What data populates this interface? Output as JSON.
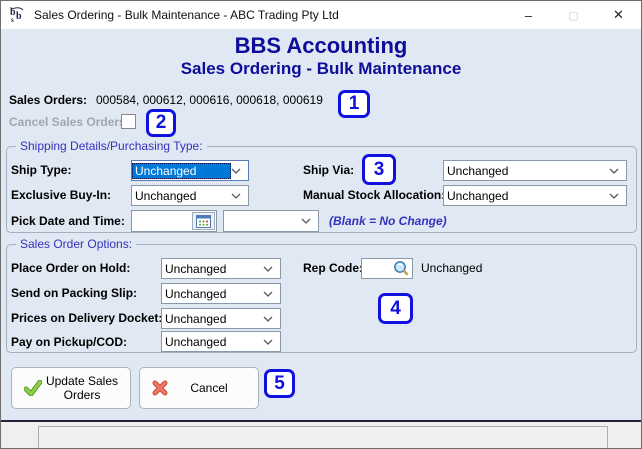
{
  "window": {
    "title": "Sales Ordering - Bulk Maintenance - ABC Trading Pty Ltd",
    "controls": {
      "minimize": "–",
      "maximize": "▢",
      "close": "✕"
    }
  },
  "header": {
    "app_title": "BBS Accounting",
    "screen_title": "Sales Ordering - Bulk Maintenance"
  },
  "sales_orders": {
    "label": "Sales Orders:",
    "value": "000584, 000612, 000616, 000618, 000619"
  },
  "cancel_orders": {
    "label": "Cancel Sales Orders:",
    "checked": false
  },
  "shipping": {
    "legend": "Shipping Details/Purchasing Type:",
    "ship_type": {
      "label": "Ship Type:",
      "value": "Unchanged"
    },
    "ship_via": {
      "label": "Ship Via:",
      "value": "Unchanged"
    },
    "exclusive_buy_in": {
      "label": "Exclusive Buy-In:",
      "value": "Unchanged"
    },
    "manual_stock_allocation": {
      "label": "Manual Stock Allocation:",
      "value": "Unchanged"
    },
    "pick_date_time": {
      "label": "Pick Date and Time:",
      "date_value": "",
      "time_value": ""
    },
    "hint": "(Blank = No Change)"
  },
  "options": {
    "legend": "Sales Order Options:",
    "rows": [
      {
        "label": "Place Order on Hold:",
        "value": "Unchanged"
      },
      {
        "label": "Send on Packing Slip:",
        "value": "Unchanged"
      },
      {
        "label": "Prices on Delivery Docket:",
        "value": "Unchanged"
      },
      {
        "label": "Pay on Pickup/COD:",
        "value": "Unchanged"
      }
    ],
    "rep_code": {
      "label": "Rep Code:",
      "value": "",
      "status": "Unchanged"
    }
  },
  "buttons": {
    "update_label": "Update Sales Orders",
    "cancel_label": "Cancel"
  },
  "badges": [
    "1",
    "2",
    "3",
    "4",
    "5"
  ],
  "icons": {
    "app": "bbs-logo",
    "search": "magnifier-icon",
    "calendar": "calendar-icon",
    "update": "green-check-icon",
    "cancel": "red-cross-icon"
  },
  "colors": {
    "background": "#dfe8f3",
    "header_navy": "#0d0d99",
    "group_label_blue": "#3333bb",
    "badge_blue": "#1010df",
    "selection_blue": "#0078d7",
    "check_green": "#76c043",
    "cross_red": "#e5604f"
  }
}
